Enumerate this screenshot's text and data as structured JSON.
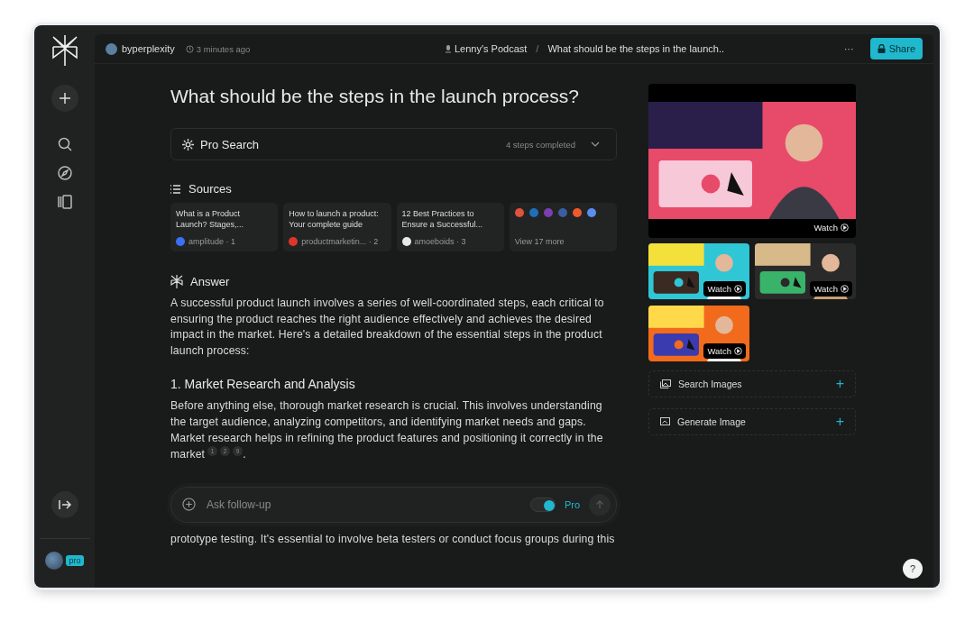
{
  "sidebar": {
    "pro_badge": "pro"
  },
  "header": {
    "user": "byperplexity",
    "time": "3 minutes ago",
    "collection": "Lenny's Podcast",
    "separator": "/",
    "thread_title": "What should be the steps in the launch..",
    "more": "···",
    "share": "Share"
  },
  "question": "What should be the steps in the launch process?",
  "pro_search": {
    "label": "Pro Search",
    "status": "4 steps completed",
    "expanded": false
  },
  "sources": {
    "heading": "Sources",
    "items": [
      {
        "title": "What is a Product Launch? Stages,...",
        "site": "amplitude",
        "index": "1",
        "color": "#3b6ff5"
      },
      {
        "title": "How to launch a product: Your complete guide",
        "site": "productmarketin...",
        "index": "2",
        "color": "#e0352b"
      },
      {
        "title": "12 Best Practices to Ensure a Successful...",
        "site": "amoeboids",
        "index": "3",
        "color": "#e8e8e8"
      }
    ],
    "dot": "·",
    "more_icons": [
      {
        "color": "#e0523d"
      },
      {
        "color": "#1d6fb8"
      },
      {
        "color": "#7a3fb0"
      },
      {
        "color": "#3a5fa0"
      },
      {
        "color": "#f05a28"
      },
      {
        "color": "#5b8def"
      }
    ],
    "more": "View 17 more"
  },
  "answer": {
    "heading": "Answer",
    "blocks": [
      {
        "kind": "paragraph",
        "text": "A successful product launch involves a series of well-coordinated steps, each critical to ensuring the product reaches the right audience effectively and achieves the desired impact in the market. Here's a detailed breakdown of the essential steps in the product launch process:"
      },
      {
        "kind": "heading",
        "text": "1. Market Research and Analysis"
      },
      {
        "kind": "paragraph",
        "text": "Before anything else, thorough market research is crucial. This involves understanding the target audience, analyzing competitors, and identifying market needs and gaps. Market research helps in refining the product features and positioning it correctly in the market",
        "citations": [
          "1",
          "2",
          "9"
        ],
        "end": "."
      }
    ]
  },
  "followup": {
    "placeholder": "Ask follow-up",
    "pro_label": "Pro",
    "pro_on": true
  },
  "below": "prototype testing. It's essential to involve beta testers or conduct focus groups during this",
  "videos": [
    {
      "kind": "featured",
      "watch": "Watch"
    },
    {
      "kind": "thumbnail",
      "watch": "Watch"
    },
    {
      "kind": "thumbnail",
      "watch": "Watch"
    },
    {
      "kind": "thumbnail",
      "watch": "Watch"
    }
  ],
  "image_actions": [
    {
      "label": "Search Images",
      "action": "+"
    },
    {
      "label": "Generate Image",
      "action": "+"
    }
  ],
  "help": "?"
}
